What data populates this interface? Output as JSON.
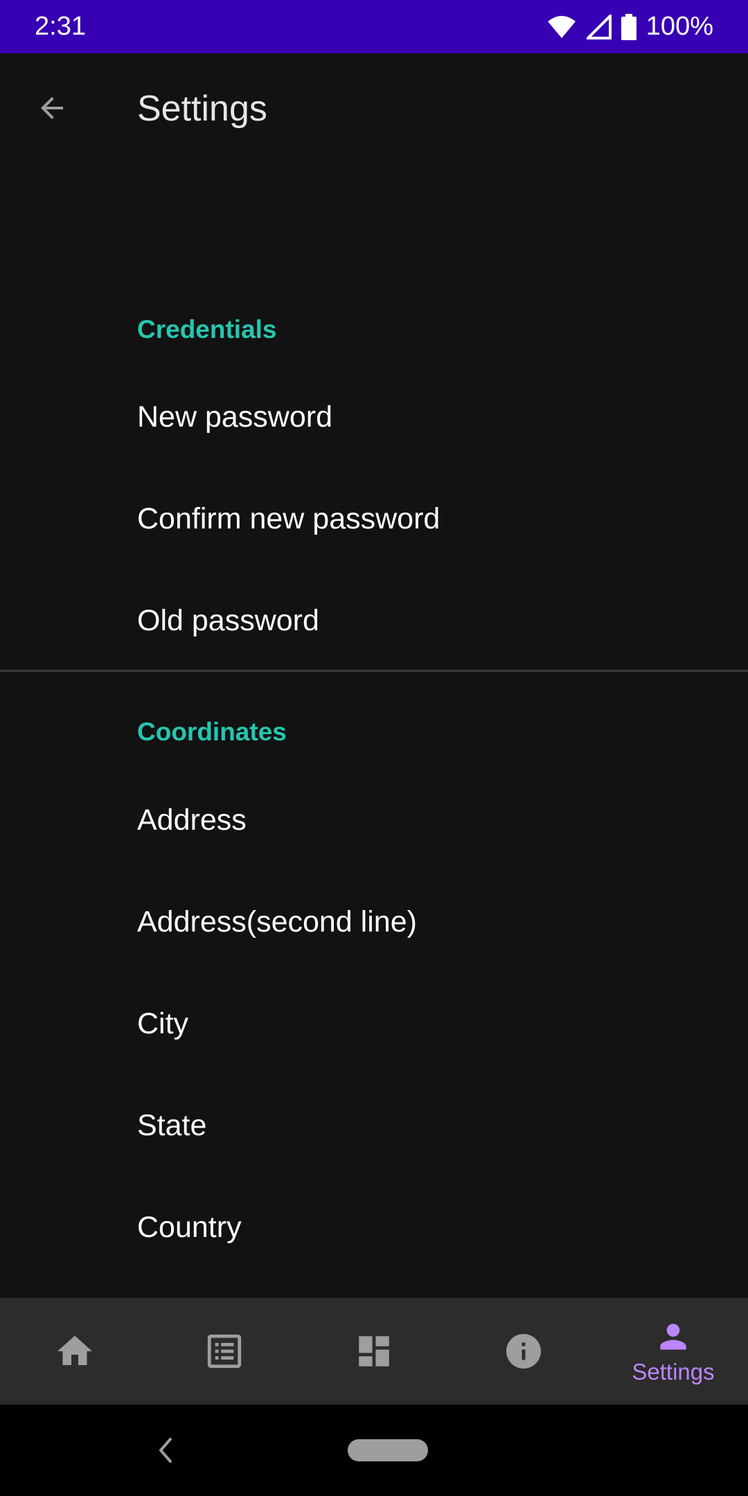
{
  "status_bar": {
    "time": "2:31",
    "battery": "100%",
    "background": "#3700b3"
  },
  "app_bar": {
    "title": "Settings"
  },
  "categories": [
    {
      "title": "Credentials",
      "items": [
        "New password",
        "Confirm new password",
        "Old password"
      ]
    },
    {
      "title": "Coordinates",
      "items": [
        "Address",
        "Address(second line)",
        "City",
        "State",
        "Country"
      ]
    }
  ],
  "bottom_nav": {
    "items": [
      {
        "icon": "home-icon",
        "label": "",
        "selected": false
      },
      {
        "icon": "list-icon",
        "label": "",
        "selected": false
      },
      {
        "icon": "dashboard-icon",
        "label": "",
        "selected": false
      },
      {
        "icon": "info-icon",
        "label": "",
        "selected": false
      },
      {
        "icon": "person-icon",
        "label": "Settings",
        "selected": true
      }
    ]
  },
  "colors": {
    "accent": "#26c6b0",
    "selected_nav": "#bb86fc",
    "background": "#121212"
  }
}
